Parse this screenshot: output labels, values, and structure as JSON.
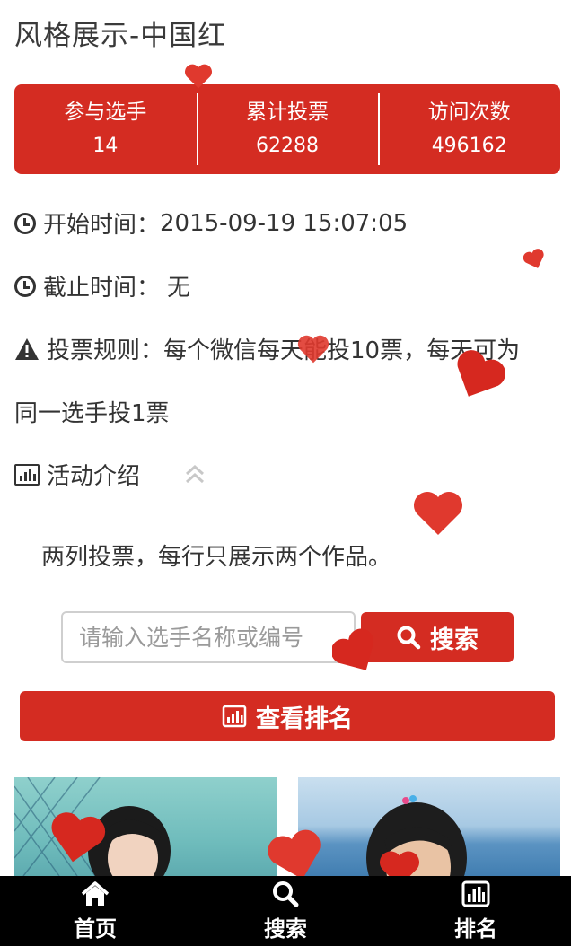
{
  "page": {
    "title": "风格展示-中国红"
  },
  "stats": [
    {
      "label": "参与选手",
      "value": "14"
    },
    {
      "label": "累计投票",
      "value": "62288"
    },
    {
      "label": "访问次数",
      "value": "496162"
    }
  ],
  "info": {
    "start_label": "开始时间：",
    "start_value": "2015-09-19 15:07:05",
    "end_label": "截止时间：",
    "end_value": "无",
    "rules_label": "投票规则：",
    "rules_line1": "每个微信每天能投10票，每天可为",
    "rules_line2": "同一选手投1票",
    "intro_label": "活动介绍",
    "intro_text": "两列投票，每行只展示两个作品。"
  },
  "search": {
    "placeholder": "请输入选手名称或编号",
    "button_label": "搜索"
  },
  "ranking": {
    "button_label": "查看排名"
  },
  "bottom_nav": [
    {
      "label": "首页",
      "icon": "home-icon"
    },
    {
      "label": "搜索",
      "icon": "search-icon"
    },
    {
      "label": "排名",
      "icon": "bar-chart-icon"
    }
  ],
  "colors": {
    "accent": "#d42c22",
    "nav_bg": "#000000",
    "text": "#333333"
  }
}
